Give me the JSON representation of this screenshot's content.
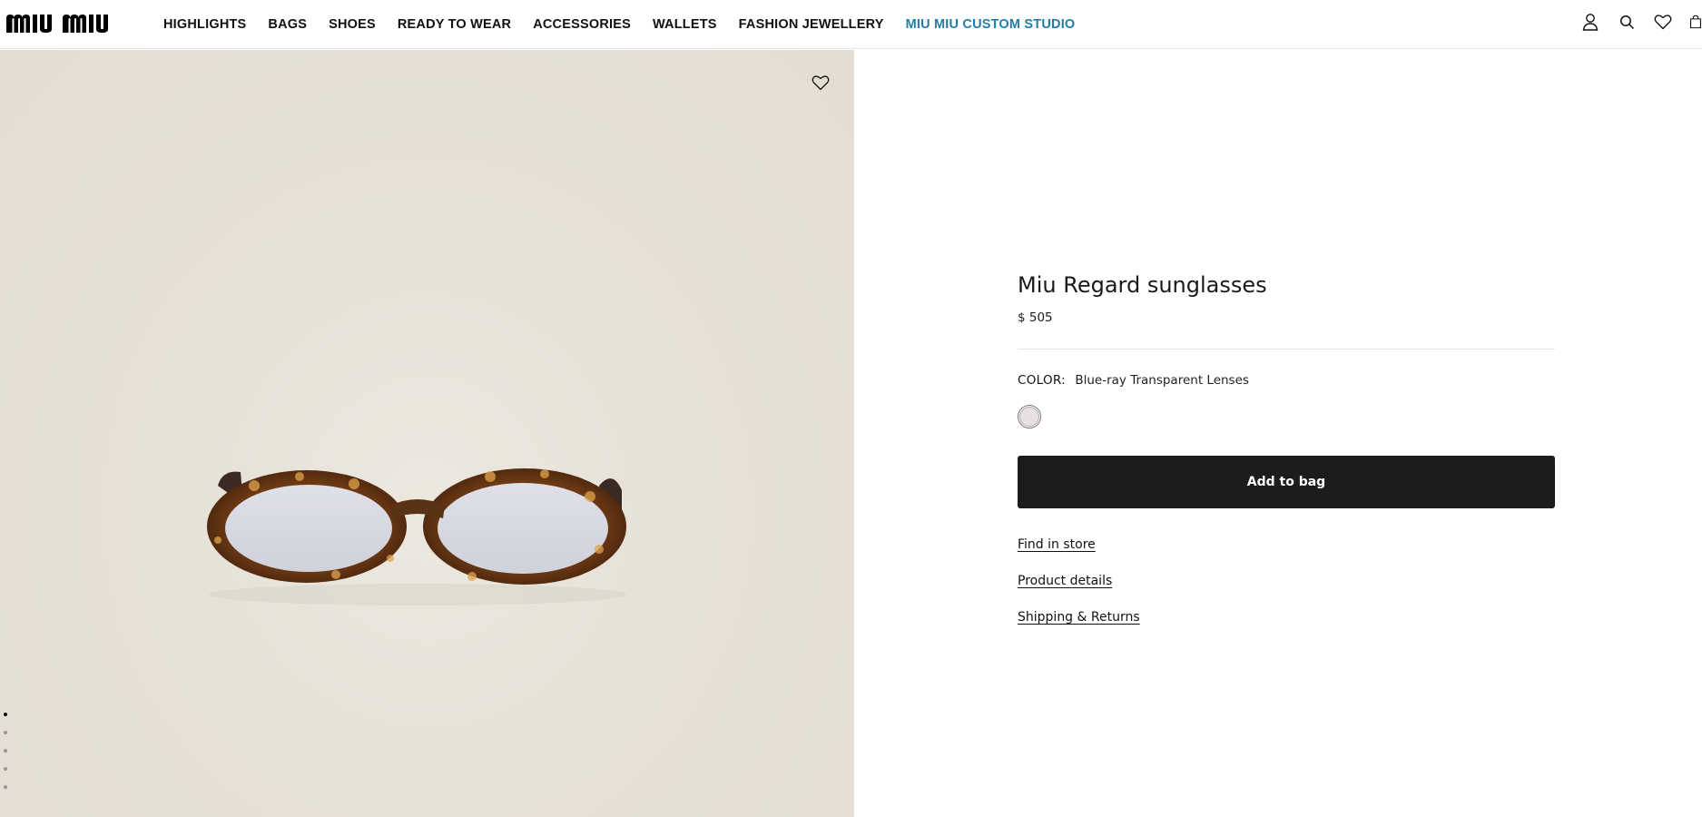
{
  "header": {
    "logo_text": "MIU MIU",
    "nav": [
      {
        "label": "HIGHLIGHTS"
      },
      {
        "label": "BAGS"
      },
      {
        "label": "SHOES"
      },
      {
        "label": "READY TO WEAR"
      },
      {
        "label": "ACCESSORIES"
      },
      {
        "label": "WALLETS"
      },
      {
        "label": "FASHION JEWELLERY"
      },
      {
        "label": "MIU MIU CUSTOM STUDIO"
      }
    ],
    "icons": [
      "account-icon",
      "search-icon",
      "wishlist-icon",
      "bag-icon"
    ],
    "custom_studio_color": "#1f7ea8"
  },
  "gallery": {
    "background_color": "#e8e3da",
    "wishlist_icon": "heart-icon",
    "dots_count": 5,
    "active_dot": 0
  },
  "product": {
    "title": "Miu Regard sunglasses",
    "price": "$ 505",
    "color_label": "COLOR:",
    "color_value": "Blue-ray Transparent Lenses",
    "swatch_color": "#e8dfe1",
    "add_to_bag": "Add to bag",
    "links": {
      "find_in_store": "Find in store",
      "product_details": "Product details",
      "shipping_returns": "Shipping & Returns"
    }
  }
}
